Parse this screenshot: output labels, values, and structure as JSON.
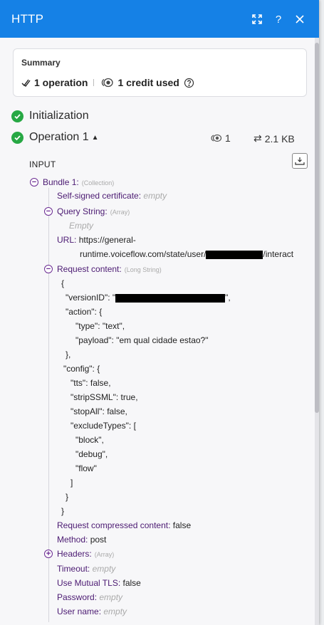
{
  "header": {
    "title": "HTTP"
  },
  "summary": {
    "title": "Summary",
    "operations": "1 operation",
    "credits": "1 credit used"
  },
  "steps": {
    "initialization": "Initialization",
    "operation": "Operation 1",
    "operations_count": "1",
    "size": "2.1 KB"
  },
  "input_label": "INPUT",
  "bundle": {
    "label": "Bundle 1:",
    "type": "(Collection)",
    "self_signed_label": "Self-signed certificate:",
    "self_signed_value": "empty",
    "query_label": "Query String:",
    "query_type": "(Array)",
    "query_value": "Empty",
    "url_label": "URL:",
    "url_line1": "https://general-",
    "url_line2_a": "runtime.voiceflow.com/state/user/",
    "url_line2_b": "/interact",
    "request_content_label": "Request content:",
    "request_content_type": "(Long String)",
    "json_lines": [
      "{",
      "\"versionID\": \"",
      "\",",
      "\"action\": {",
      "\"type\": \"text\",",
      "\"payload\": \"em qual cidade estao?\"",
      "},",
      "\"config\": {",
      "\"tts\": false,",
      "\"stripSSML\": true,",
      "\"stopAll\": false,",
      "\"excludeTypes\": [",
      "\"block\",",
      "\"debug\",",
      "\"flow\"",
      "]",
      "}",
      "}"
    ],
    "compressed_label": "Request compressed content:",
    "compressed_value": "false",
    "method_label": "Method:",
    "method_value": "post",
    "headers_label": "Headers:",
    "headers_type": "(Array)",
    "timeout_label": "Timeout:",
    "timeout_value": "empty",
    "mutual_tls_label": "Use Mutual TLS:",
    "mutual_tls_value": "false",
    "password_label": "Password:",
    "password_value": "empty",
    "username_label": "User name:",
    "username_value": "empty"
  },
  "colors": {
    "header_bg": "#1581e6",
    "success": "#27a844",
    "key": "#4b1a72"
  }
}
